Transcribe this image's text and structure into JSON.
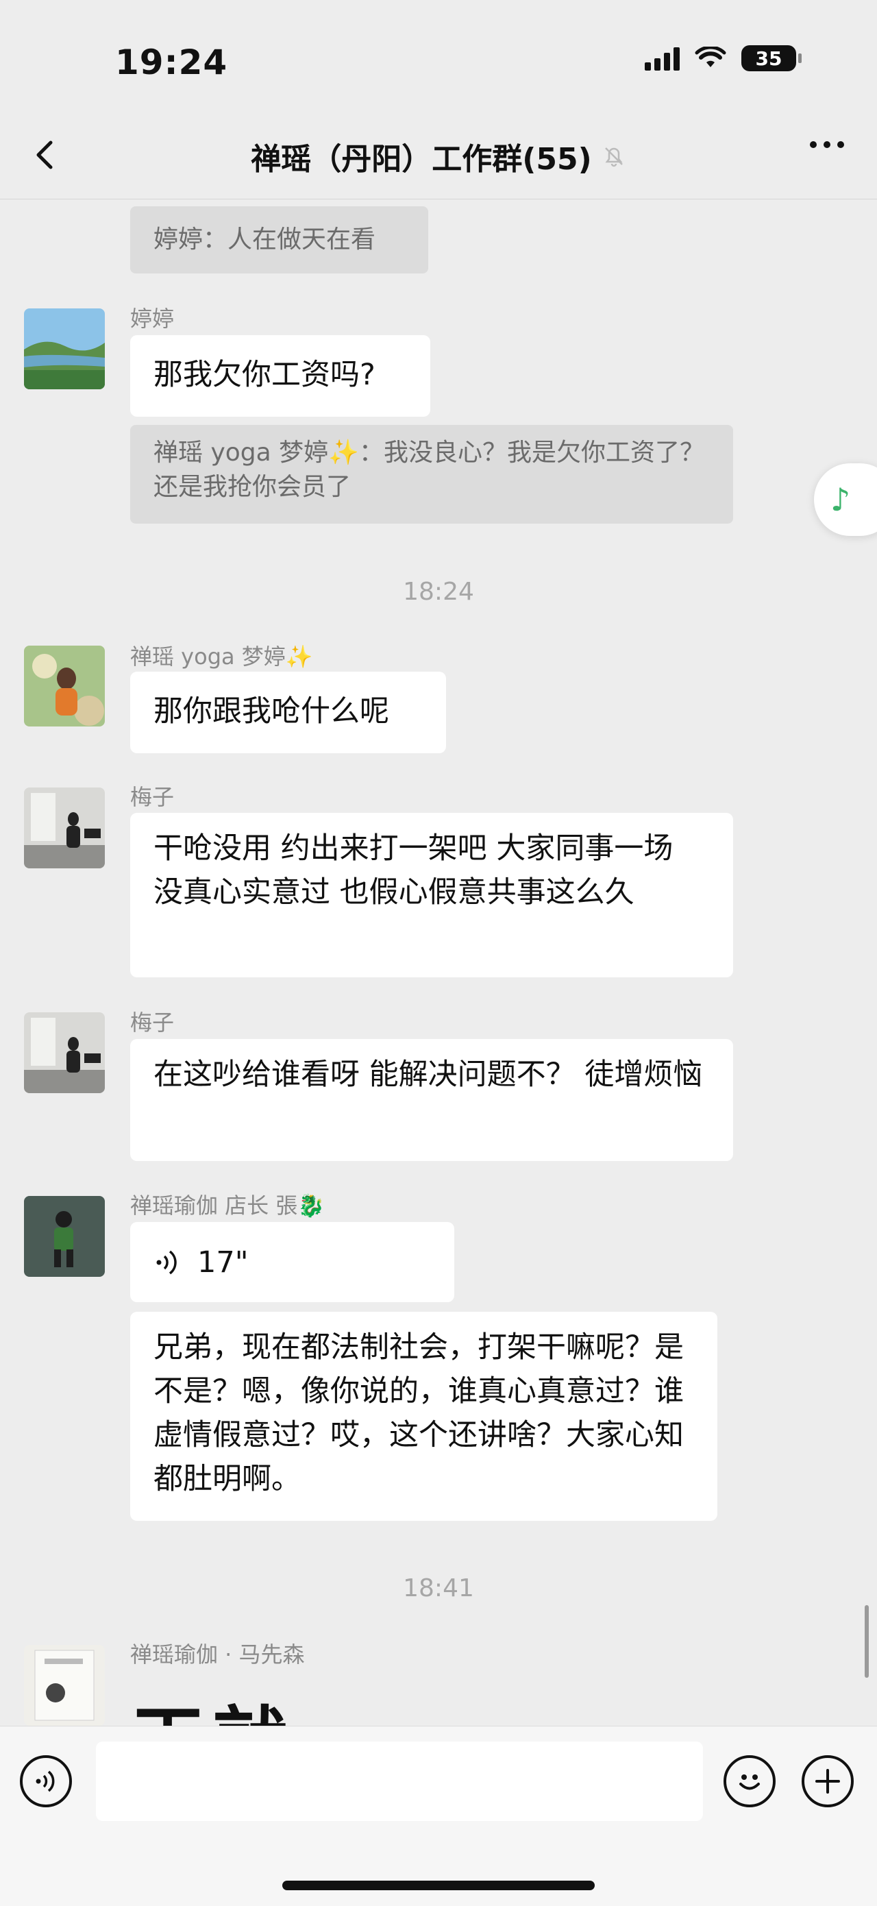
{
  "status_bar": {
    "time": "19:24",
    "battery": "35"
  },
  "header": {
    "title": "禅瑶（丹阳）工作群(55)"
  },
  "messages": {
    "quote_top": "婷婷：人在做天在看",
    "m1": {
      "sender": "婷婷",
      "text": "那我欠你工资吗?",
      "quote": "禅瑶 yoga 梦婷✨：我没良心？我是欠你工资了？还是我抢你会员了"
    },
    "ts1": "18:24",
    "m2": {
      "sender": "禅瑶 yoga 梦婷✨",
      "text": "那你跟我呛什么呢"
    },
    "m3": {
      "sender": "梅子",
      "text": "干呛没用 约出来打一架吧 大家同事一场 没真心实意过 也假心假意共事这么久"
    },
    "m4": {
      "sender": "梅子",
      "text": "在这吵给谁看呀 能解决问题不？ 徒增烦恼"
    },
    "m5": {
      "sender": "禅瑶瑜伽  店长 張🐉",
      "voice_duration": "17\"",
      "transcript": "兄弟，现在都法制社会，打架干嘛呢？是不是？嗯，像你说的，谁真心真意过？谁虚情假意过？哎，这个还讲啥？大家心知都肚明啊。"
    },
    "ts2": "18:41",
    "m6": {
      "sender": "禅瑶瑜伽 · 马先森",
      "image_text": "干就"
    }
  },
  "icons": {
    "back": "chevron-left-icon",
    "mute": "bell-off-icon",
    "more": "more-dots-icon",
    "music": "music-note-icon",
    "voice": "voice-input-icon",
    "emoji": "emoji-icon",
    "plus": "plus-icon"
  }
}
